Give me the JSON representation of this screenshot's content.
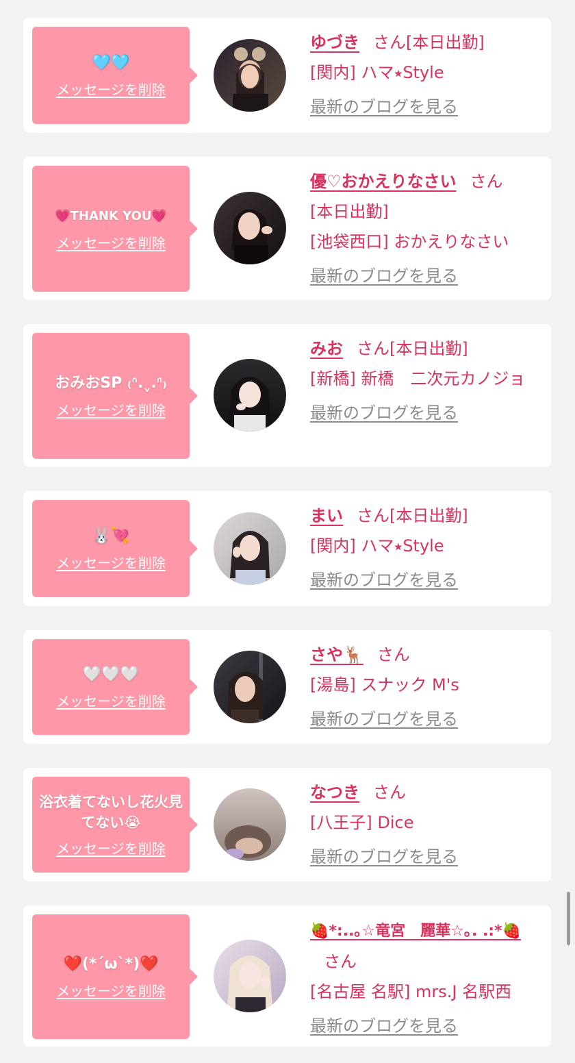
{
  "accent_color": "#d8335e",
  "bubble_color": "#fe97a8",
  "delete_label": "メッセージを削除",
  "blog_label": "最新のブログを見る",
  "san_label": "さん",
  "entries": [
    {
      "message": "🩵🩵",
      "name": "ゆづき",
      "status": "[本日出勤]",
      "shop": "[関内] ハマ⭑Style"
    },
    {
      "message": "💗THANK YOU💗",
      "name": "優♡おかえりなさい",
      "status": "[本日出勤]",
      "shop": "[池袋西口] おかえりなさい"
    },
    {
      "message": "おみおSP ₍ᐢ.ˬ.ᐢ₎",
      "name": "みお",
      "status": "[本日出勤]",
      "shop": "[新橋] 新橋　二次元カノジョ"
    },
    {
      "message": "🐰💘",
      "name": "まい",
      "status": "[本日出勤]",
      "shop": "[関内] ハマ⭑Style"
    },
    {
      "message": "🤍🤍🤍",
      "name": "さや🦌",
      "status": "",
      "shop": "[湯島] スナック M's"
    },
    {
      "message": "浴衣着てないし花火見てない😭",
      "name": "なつき",
      "status": "",
      "shop": "[八王子] Dice"
    },
    {
      "message": "❤️(*´ω`*)❤️",
      "name": "🍓*:..｡☆竜宮　麗華☆｡. .:*🍓",
      "status": "",
      "shop": "[名古屋 名駅] mrs.J 名駅西"
    }
  ]
}
